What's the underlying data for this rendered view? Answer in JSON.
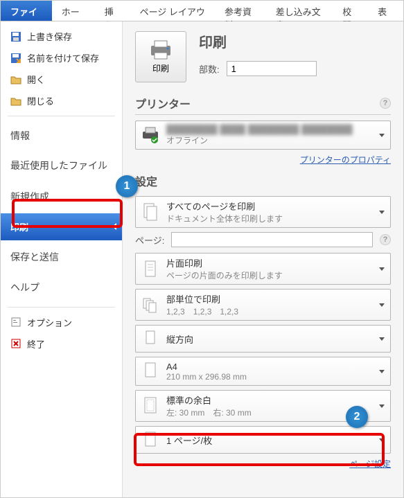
{
  "ribbon": {
    "tabs": [
      "ファイル",
      "ホーム",
      "挿入",
      "ページ レイアウト",
      "参考資料",
      "差し込み文書",
      "校閲",
      "表示"
    ],
    "active_index": 0
  },
  "sidebar": {
    "items": [
      {
        "label": "上書き保存",
        "icon": "save"
      },
      {
        "label": "名前を付けて保存",
        "icon": "save-as"
      },
      {
        "label": "開く",
        "icon": "folder-open"
      },
      {
        "label": "閉じる",
        "icon": "folder-close"
      }
    ],
    "items2": [
      {
        "label": "情報"
      },
      {
        "label": "最近使用したファイル"
      },
      {
        "label": "新規作成"
      },
      {
        "label": "印刷",
        "selected": true
      },
      {
        "label": "保存と送信"
      },
      {
        "label": "ヘルプ"
      }
    ],
    "items3": [
      {
        "label": "オプション",
        "icon": "options"
      },
      {
        "label": "終了",
        "icon": "exit"
      }
    ]
  },
  "main": {
    "print_heading": "印刷",
    "print_button": "印刷",
    "copies_label": "部数:",
    "copies_value": "1",
    "printer_heading": "プリンター",
    "printer_status": "オフライン",
    "printer_props_link": "プリンターのプロパティ",
    "settings_heading": "設定",
    "pages_label": "ページ:",
    "dd_scope": {
      "line1": "すべてのページを印刷",
      "line2": "ドキュメント全体を印刷します"
    },
    "dd_sides": {
      "line1": "片面印刷",
      "line2": "ページの片面のみを印刷します"
    },
    "dd_collate": {
      "line1": "部単位で印刷",
      "line2": "1,2,3　1,2,3　1,2,3"
    },
    "dd_orient": {
      "line1": "縦方向"
    },
    "dd_paper": {
      "line1": "A4",
      "line2": "210 mm x 296.98 mm"
    },
    "dd_margin": {
      "line1": "標準の余白",
      "line2": "左: 30 mm　右: 30 mm"
    },
    "dd_pps": {
      "line1": "1 ページ/枚"
    },
    "page_setup_link": "ページ設定"
  },
  "annotations": {
    "a1": "1",
    "a2": "2"
  }
}
